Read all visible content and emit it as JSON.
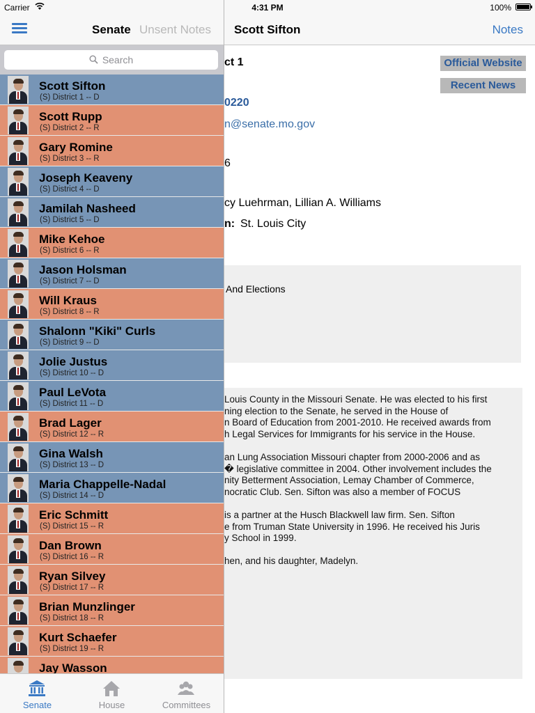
{
  "status_bar": {
    "carrier": "Carrier",
    "time": "4:31 PM",
    "battery": "100%"
  },
  "master": {
    "segment_active": "Senate",
    "segment_inactive": "Unsent Notes",
    "search_placeholder": "Search",
    "party_colors": {
      "D": "#7795b6",
      "R": "#e19173"
    },
    "senators": [
      {
        "name": "Scott Sifton",
        "sub": "(S) District 1 -- D",
        "party": "D"
      },
      {
        "name": "Scott Rupp",
        "sub": "(S) District 2 -- R",
        "party": "R"
      },
      {
        "name": "Gary Romine",
        "sub": "(S) District 3 -- R",
        "party": "R"
      },
      {
        "name": "Joseph Keaveny",
        "sub": "(S) District 4 -- D",
        "party": "D"
      },
      {
        "name": "Jamilah Nasheed",
        "sub": "(S) District 5 -- D",
        "party": "D"
      },
      {
        "name": "Mike Kehoe",
        "sub": "(S) District 6 -- R",
        "party": "R"
      },
      {
        "name": "Jason Holsman",
        "sub": "(S) District 7 -- D",
        "party": "D"
      },
      {
        "name": "Will Kraus",
        "sub": "(S) District 8 -- R",
        "party": "R"
      },
      {
        "name": "Shalonn \"Kiki\" Curls",
        "sub": "(S) District 9 -- D",
        "party": "D"
      },
      {
        "name": "Jolie Justus",
        "sub": "(S) District 10 -- D",
        "party": "D"
      },
      {
        "name": "Paul LeVota",
        "sub": "(S) District 11 -- D",
        "party": "D"
      },
      {
        "name": "Brad Lager",
        "sub": "(S) District 12 -- R",
        "party": "R"
      },
      {
        "name": "Gina Walsh",
        "sub": "(S) District 13 -- D",
        "party": "D"
      },
      {
        "name": "Maria Chappelle-Nadal",
        "sub": "(S) District 14 -- D",
        "party": "D"
      },
      {
        "name": "Eric  Schmitt",
        "sub": "(S) District 15 -- R",
        "party": "R"
      },
      {
        "name": "Dan Brown",
        "sub": "(S) District 16 -- R",
        "party": "R"
      },
      {
        "name": "Ryan Silvey",
        "sub": "(S) District 17 -- R",
        "party": "R"
      },
      {
        "name": "Brian Munzlinger",
        "sub": "(S) District 18 -- R",
        "party": "R"
      },
      {
        "name": "Kurt Schaefer",
        "sub": "(S) District 19 -- R",
        "party": "R"
      },
      {
        "name": "Jay Wasson",
        "sub": "",
        "party": "R"
      }
    ],
    "tabs": [
      {
        "label": "Senate",
        "icon": "capitol-building-icon",
        "active": true
      },
      {
        "label": "House",
        "icon": "house-icon",
        "active": false
      },
      {
        "label": "Committees",
        "icon": "people-icon",
        "active": false
      }
    ]
  },
  "detail": {
    "title": "Scott Sifton",
    "notes_label": "Notes",
    "official_website_label": "Official Website",
    "recent_news_label": "Recent News",
    "district_fragment": "ct 1",
    "phone_fragment": "0220",
    "email_fragment": "n@senate.mo.gov",
    "room_fragment": "6",
    "staff_fragment": "cy Luehrman, Lillian A. Williams",
    "residence_label_fragment": "n:",
    "residence_value": "St. Louis City",
    "committee_fragment": "And Elections",
    "bio_lines": [
      "Louis County in the Missouri Senate. He was elected to his first",
      "ning election to the Senate, he served in the House of",
      "n Board of Education from 2001-2010.  He received awards from",
      "h Legal Services for Immigrants for his service in the House.",
      "",
      "an Lung Association Missouri chapter from 2000-2006 and as",
      "� legislative committee in 2004. Other involvement includes the",
      "nity Betterment Association, Lemay Chamber of Commerce,",
      "nocratic Club. Sen. Sifton was also a member of FOCUS",
      "",
      " is a partner at the Husch Blackwell law firm. Sen. Sifton",
      "e from Truman State University in 1996. He received his Juris",
      "y School in 1999.",
      "",
      "hen, and his daughter, Madelyn."
    ]
  }
}
